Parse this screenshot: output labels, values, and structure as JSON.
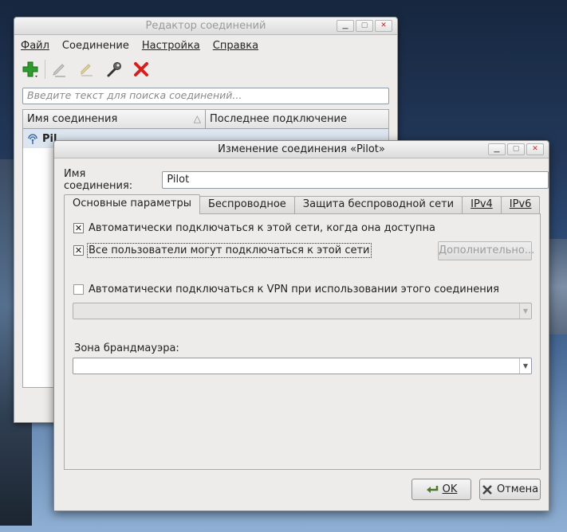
{
  "background_window": {
    "title": "Редактор соединений",
    "menu": [
      {
        "label": "Файл"
      },
      {
        "label": "Соединение"
      },
      {
        "label": "Настройка"
      },
      {
        "label": "Справка"
      }
    ],
    "toolbar_icons": [
      "add-icon",
      "edit-icon",
      "copy-icon",
      "settings-wrench-icon",
      "delete-icon"
    ],
    "search_placeholder": "Введите текст для поиска соединений...",
    "columns": [
      "Имя соединения",
      "Последнее подключение"
    ],
    "rows": [
      {
        "name": "Pil",
        "icon": "wireless-icon"
      }
    ]
  },
  "dialog": {
    "title": "Изменение соединения «Pilot»",
    "name_label": "Имя соединения:",
    "name_value": "Pilot",
    "tabs": [
      "Основные параметры",
      "Беспроводное",
      "Защита беспроводной сети",
      "IPv4",
      "IPv6"
    ],
    "active_tab": 0,
    "auto_connect_label": "Автоматически подключаться к этой сети, когда она доступна",
    "auto_connect_checked": true,
    "all_users_label": "Все пользователи могут подключаться к этой сети",
    "all_users_checked": true,
    "advanced_button": "Дополнительно...",
    "vpn_label": "Автоматически подключаться к VPN при использовании этого соединения",
    "vpn_checked": false,
    "vpn_combo_value": "",
    "firewall_label": "Зона брандмауэра:",
    "firewall_combo_value": "",
    "ok_button": "OK",
    "cancel_button": "Отмена"
  },
  "colors": {
    "add": "#2e9b2e",
    "delete": "#d42020",
    "list_selection": "#dde6f0"
  }
}
